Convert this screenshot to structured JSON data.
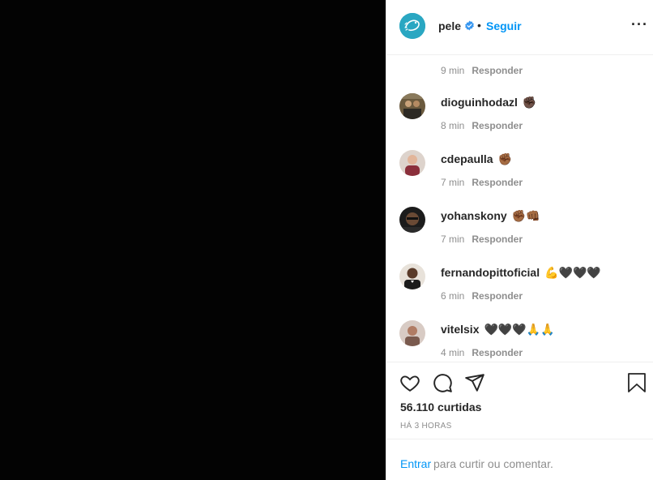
{
  "post": {
    "username": "pele",
    "follow_label": "Seguir",
    "separator": "•",
    "likes": "56.110 curtidas",
    "time_ago": "HÁ 3 HORAS"
  },
  "comments": [
    {
      "user": "",
      "emoji": "",
      "time": "9 min",
      "reply": "Responder"
    },
    {
      "user": "dioguinhodazl",
      "emoji": "✊🏿",
      "time": "8 min",
      "reply": "Responder"
    },
    {
      "user": "cdepaulla",
      "emoji": "✊🏾",
      "time": "7 min",
      "reply": "Responder"
    },
    {
      "user": "yohanskony",
      "emoji": "✊🏾👊🏾",
      "time": "7 min",
      "reply": "Responder"
    },
    {
      "user": "fernandopittoficial",
      "emoji": "💪🖤🖤🖤",
      "time": "6 min",
      "reply": "Responder"
    },
    {
      "user": "vitelsix",
      "emoji": "🖤🖤🖤🙏🙏",
      "time": "4 min",
      "reply": "Responder"
    }
  ],
  "footer": {
    "login_label": "Entrar",
    "prompt": "para curtir ou comentar."
  },
  "colors": {
    "accent": "#0095f6",
    "text": "#262626",
    "muted": "#8e8e8e",
    "media_background": "#030303"
  },
  "icons": [
    "like-heart-icon",
    "comment-icon",
    "share-icon",
    "save-bookmark-icon",
    "verified-badge-icon",
    "more-options-icon"
  ]
}
